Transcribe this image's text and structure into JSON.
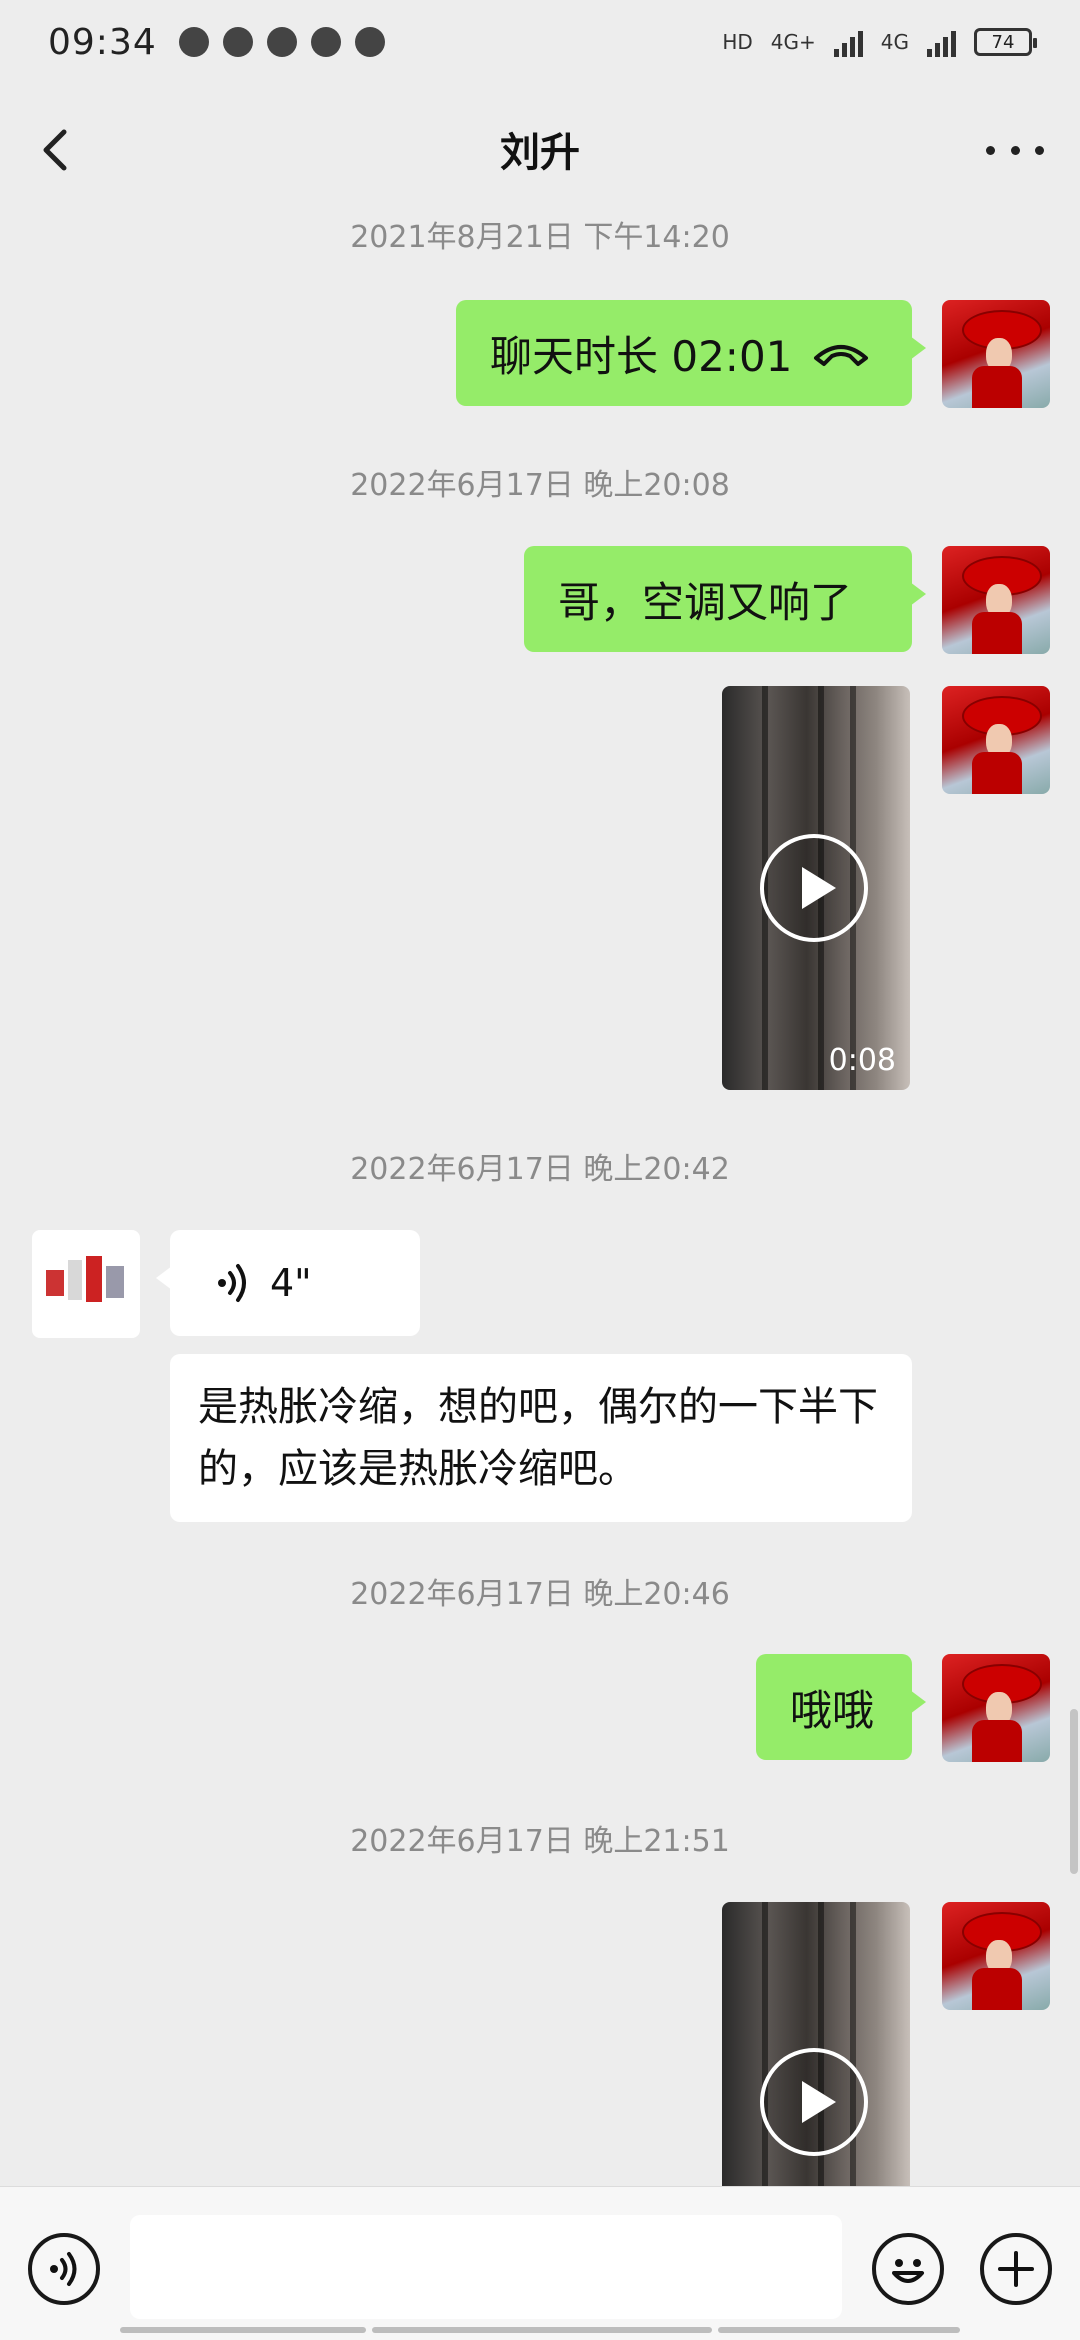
{
  "status_bar": {
    "time": "09:34",
    "network_label": "HD",
    "sim1_label": "4G+",
    "sim2_label": "4G",
    "battery": "74"
  },
  "header": {
    "title": "刘升",
    "back_icon": "chevron-left-icon",
    "more_icon": "more-dots-icon"
  },
  "messages": [
    {
      "type": "timestamp",
      "text": "2021年8月21日 下午14:20"
    },
    {
      "type": "call",
      "from": "me",
      "text": "聊天时长 02:01",
      "icon": "phone-hangup-icon"
    },
    {
      "type": "timestamp",
      "text": "2022年6月17日 晚上20:08"
    },
    {
      "type": "text",
      "from": "me",
      "text": "哥，空调又响了"
    },
    {
      "type": "video",
      "from": "me",
      "duration": "0:08"
    },
    {
      "type": "timestamp",
      "text": "2022年6月17日 晚上20:42"
    },
    {
      "type": "voice",
      "from": "them",
      "duration": "4\""
    },
    {
      "type": "text",
      "from": "them",
      "text": "是热胀冷缩，想的吧，偶尔的一下半下的，应该是热胀冷缩吧。"
    },
    {
      "type": "timestamp",
      "text": "2022年6月17日 晚上20:46"
    },
    {
      "type": "text",
      "from": "me",
      "text": "哦哦"
    },
    {
      "type": "timestamp",
      "text": "2022年6月17日 晚上21:51"
    },
    {
      "type": "video",
      "from": "me",
      "duration": ""
    }
  ],
  "input_bar": {
    "voice_icon": "voice-input-icon",
    "emoji_icon": "emoji-icon",
    "plus_icon": "plus-icon",
    "input_value": ""
  },
  "colors": {
    "bubble_me": "#95ec69",
    "bubble_them": "#ffffff",
    "background": "#ededed"
  }
}
